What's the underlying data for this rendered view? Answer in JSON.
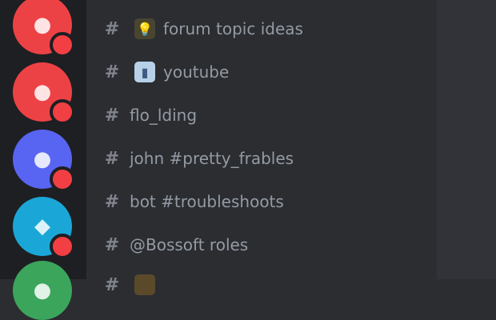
{
  "servers": [
    {
      "icon": "server-red",
      "color": "#ed4245"
    },
    {
      "icon": "server-red",
      "color": "#ed4245"
    },
    {
      "icon": "server-blurple",
      "color": "#5865f2"
    },
    {
      "icon": "server-blue",
      "color": "#1aa7d8"
    },
    {
      "icon": "server-green",
      "color": "#3ba55c"
    }
  ],
  "channels": [
    {
      "name": "forum topic ideas",
      "emoji": "bulb"
    },
    {
      "name": "youtube",
      "emoji": "tv"
    },
    {
      "name": "flo_lding"
    },
    {
      "name": "john #pretty_frables"
    },
    {
      "name": "bot #troubleshoots"
    },
    {
      "name": "@Bossoft roles"
    }
  ],
  "colors": {
    "rail": "#1e1f22",
    "sidebar": "#2b2d31",
    "channel_text": "#949ba4",
    "unread_badge": "#f23f43"
  }
}
